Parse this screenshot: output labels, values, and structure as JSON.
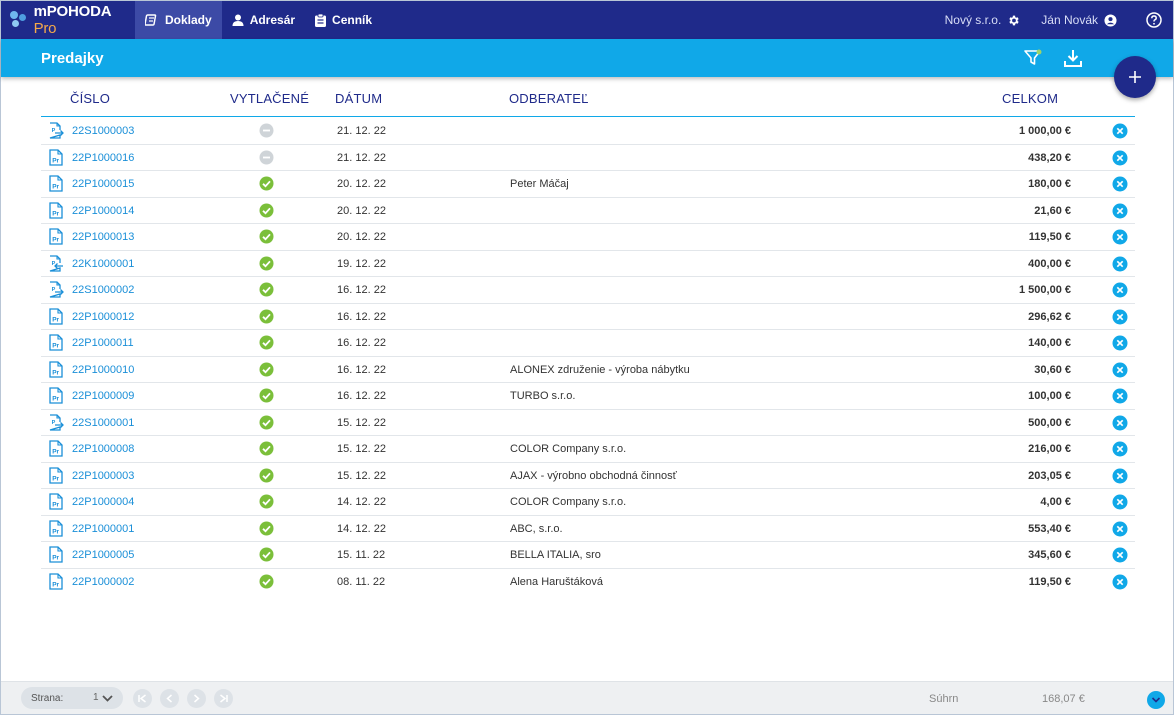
{
  "app": {
    "name": "mPOHODA",
    "edition": "Pro"
  },
  "nav": [
    {
      "label": "Doklady",
      "active": true
    },
    {
      "label": "Adresár",
      "active": false
    },
    {
      "label": "Cenník",
      "active": false
    }
  ],
  "top_right": {
    "company": "Nový s.r.o.",
    "user": "Ján Novák"
  },
  "page": {
    "title": "Predajky"
  },
  "columns": {
    "number": "ČÍSLO",
    "printed": "VYTLAČENÉ",
    "date": "DÁTUM",
    "customer": "ODBERATEĽ",
    "total": "CELKOM"
  },
  "rows": [
    {
      "number": "22S1000003",
      "doc_icon": "document-arrow-out-icon",
      "printed": false,
      "date": "21. 12. 22",
      "customer": "",
      "total": "1 000,00 €"
    },
    {
      "number": "22P1000016",
      "doc_icon": "document-pr-icon",
      "printed": false,
      "date": "21. 12. 22",
      "customer": "",
      "total": "438,20 €"
    },
    {
      "number": "22P1000015",
      "doc_icon": "document-pr-icon",
      "printed": true,
      "date": "20. 12. 22",
      "customer": "Peter Máčaj",
      "total": "180,00 €"
    },
    {
      "number": "22P1000014",
      "doc_icon": "document-pr-icon",
      "printed": true,
      "date": "20. 12. 22",
      "customer": "",
      "total": "21,60 €"
    },
    {
      "number": "22P1000013",
      "doc_icon": "document-pr-icon",
      "printed": true,
      "date": "20. 12. 22",
      "customer": "",
      "total": "119,50 €"
    },
    {
      "number": "22K1000001",
      "doc_icon": "document-arrow-in-icon",
      "printed": true,
      "date": "19. 12. 22",
      "customer": "",
      "total": "400,00 €"
    },
    {
      "number": "22S1000002",
      "doc_icon": "document-arrow-out-icon",
      "printed": true,
      "date": "16. 12. 22",
      "customer": "",
      "total": "1 500,00 €"
    },
    {
      "number": "22P1000012",
      "doc_icon": "document-pr-icon",
      "printed": true,
      "date": "16. 12. 22",
      "customer": "",
      "total": "296,62 €"
    },
    {
      "number": "22P1000011",
      "doc_icon": "document-pr-icon",
      "printed": true,
      "date": "16. 12. 22",
      "customer": "",
      "total": "140,00 €"
    },
    {
      "number": "22P1000010",
      "doc_icon": "document-pr-icon",
      "printed": true,
      "date": "16. 12. 22",
      "customer": "ALONEX združenie - výroba nábytku",
      "total": "30,60 €"
    },
    {
      "number": "22P1000009",
      "doc_icon": "document-pr-icon",
      "printed": true,
      "date": "16. 12. 22",
      "customer": "TURBO s.r.o.",
      "total": "100,00 €"
    },
    {
      "number": "22S1000001",
      "doc_icon": "document-arrow-out-icon",
      "printed": true,
      "date": "15. 12. 22",
      "customer": "",
      "total": "500,00 €"
    },
    {
      "number": "22P1000008",
      "doc_icon": "document-pr-icon",
      "printed": true,
      "date": "15. 12. 22",
      "customer": "COLOR Company s.r.o.",
      "total": "216,00 €"
    },
    {
      "number": "22P1000003",
      "doc_icon": "document-pr-icon",
      "printed": true,
      "date": "15. 12. 22",
      "customer": "AJAX - výrobno obchodná činnosť",
      "total": "203,05 €"
    },
    {
      "number": "22P1000004",
      "doc_icon": "document-pr-icon",
      "printed": true,
      "date": "14. 12. 22",
      "customer": "COLOR Company s.r.o.",
      "total": "4,00 €"
    },
    {
      "number": "22P1000001",
      "doc_icon": "document-pr-icon",
      "printed": true,
      "date": "14. 12. 22",
      "customer": "ABC, s.r.o.",
      "total": "553,40 €"
    },
    {
      "number": "22P1000005",
      "doc_icon": "document-pr-icon",
      "printed": true,
      "date": "15. 11. 22",
      "customer": "BELLA ITALIA, sro",
      "total": "345,60 €"
    },
    {
      "number": "22P1000002",
      "doc_icon": "document-pr-icon",
      "printed": true,
      "date": "08. 11. 22",
      "customer": "Alena Haruštáková",
      "total": "119,50 €"
    }
  ],
  "footer": {
    "page_label": "Strana:",
    "page_value": "1",
    "sum_label": "Súhrn",
    "sum_value": "168,07  €"
  },
  "colors": {
    "nav_bg": "#1f2a8a",
    "accent": "#10a8e8",
    "link": "#1a8fd8",
    "printed": "#7bbf3a",
    "not_printed": "#cfd4d8"
  }
}
